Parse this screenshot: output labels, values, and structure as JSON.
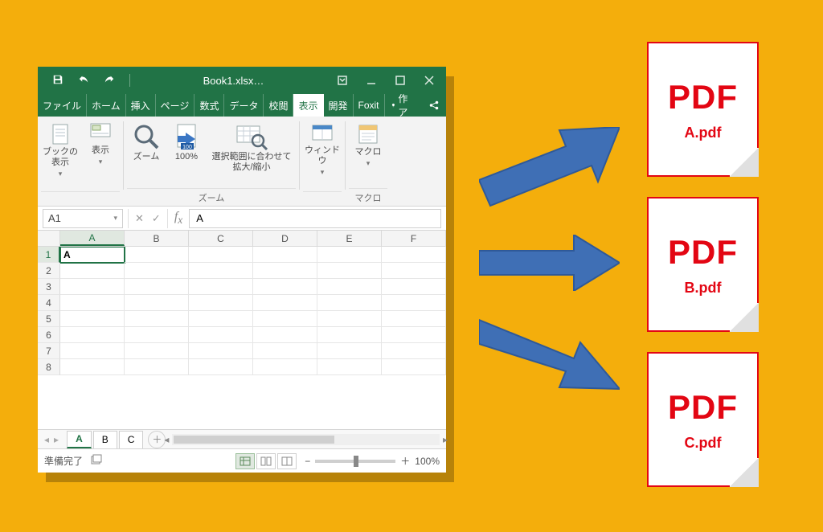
{
  "titlebar": {
    "filename": "Book1.xlsx…"
  },
  "tabs": {
    "file": "ファイル",
    "items": [
      "ホーム",
      "挿入",
      "ページ",
      "数式",
      "データ",
      "校閲",
      "表示",
      "開発",
      "Foxit"
    ],
    "active_index": 6,
    "tellme": "操作アシ"
  },
  "ribbon": {
    "g1": {
      "btn1": "ブックの\n表示",
      "btn2": "表示"
    },
    "g2": {
      "btn1": "ズーム",
      "btn2": "100%",
      "btn3": "選択範囲に合わせて\n拡大/縮小",
      "label": "ズーム"
    },
    "g3": {
      "btn1": "ウィンドウ"
    },
    "g4": {
      "btn1": "マクロ",
      "label": "マクロ"
    }
  },
  "namebox": "A1",
  "formula": "A",
  "grid": {
    "cols": [
      "A",
      "B",
      "C",
      "D",
      "E",
      "F"
    ],
    "rows": [
      "1",
      "2",
      "3",
      "4",
      "5",
      "6",
      "7",
      "8"
    ],
    "A1": "A"
  },
  "sheets": [
    "A",
    "B",
    "C"
  ],
  "status": {
    "ready": "準備完了",
    "zoom": "100%"
  },
  "pdf": {
    "label": "PDF",
    "files": [
      "A.pdf",
      "B.pdf",
      "C.pdf"
    ]
  }
}
